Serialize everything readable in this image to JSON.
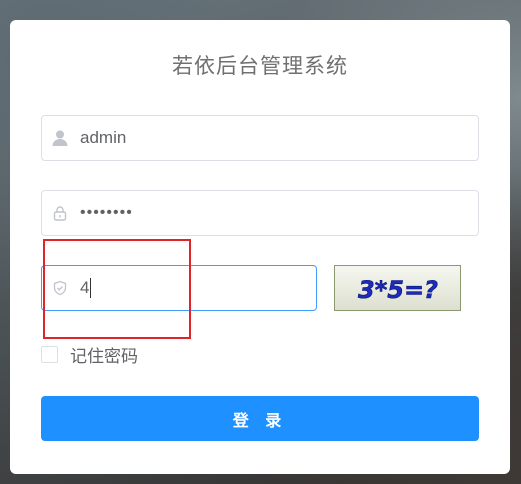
{
  "app": {
    "title": "若依后台管理系统"
  },
  "form": {
    "username": {
      "value": "admin",
      "icon": "user-icon"
    },
    "password": {
      "value": "••••••••",
      "icon": "lock-icon"
    },
    "code": {
      "value": "4",
      "icon": "shield-check-icon"
    },
    "captcha": {
      "text": "3*5=?"
    },
    "remember": {
      "label": "记住密码",
      "checked": false
    },
    "submit": {
      "label": "登 录"
    }
  },
  "colors": {
    "primary": "#1e90ff",
    "input_focus": "#409eff",
    "highlight": "#e0242a",
    "captcha_text": "#1c2bbd"
  }
}
